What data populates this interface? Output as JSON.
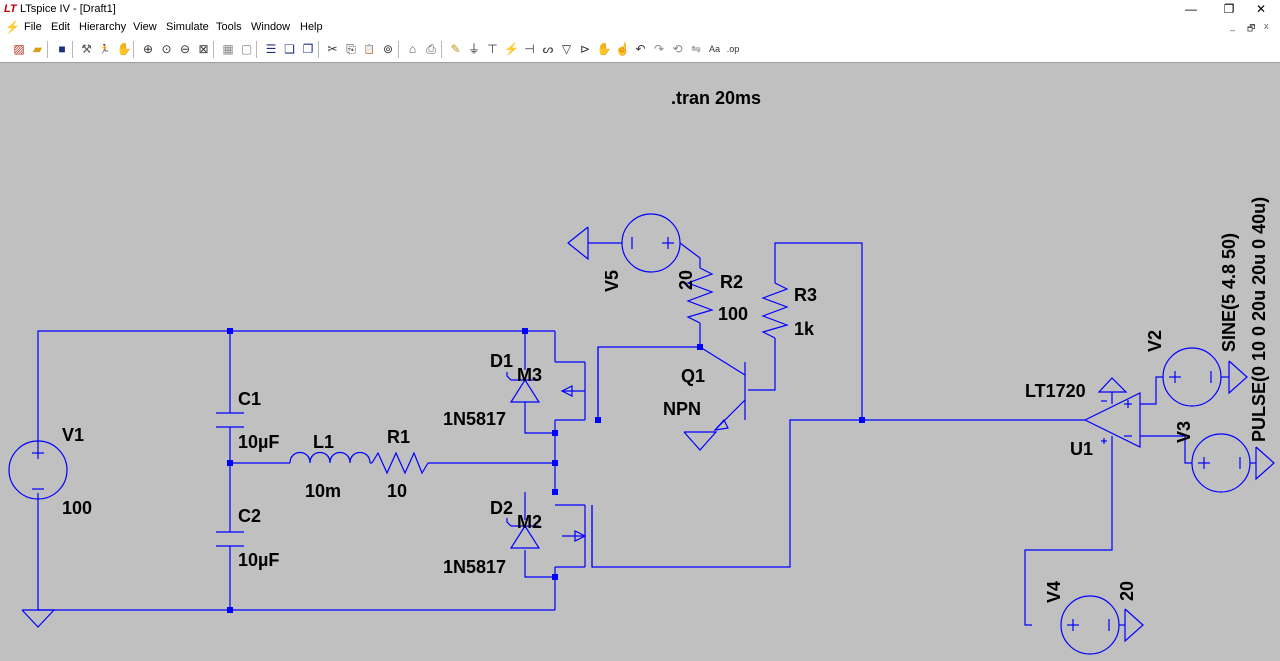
{
  "window": {
    "title": "LTspice IV - [Draft1]",
    "app_icon_glyph": "LT"
  },
  "window_controls": {
    "minimize": "—",
    "maximize": "❐",
    "close": "✕"
  },
  "mdi_controls": {
    "minimize": "_",
    "restore": "🗗",
    "close": "x"
  },
  "menu": {
    "icon_glyph": "⚡",
    "items": [
      "File",
      "Edit",
      "Hierarchy",
      "View",
      "Simulate",
      "Tools",
      "Window",
      "Help"
    ]
  },
  "toolbar": {
    "icons": [
      {
        "name": "new-schematic-icon",
        "glyph": "▨",
        "color": "#c03020"
      },
      {
        "name": "open-icon",
        "glyph": "▰",
        "color": "#d4a017"
      },
      {
        "name": "save-icon",
        "glyph": "■",
        "color": "#203080"
      },
      {
        "name": "control-panel-icon",
        "glyph": "⚒",
        "color": "#555555"
      },
      {
        "name": "run-icon",
        "glyph": "🏃",
        "color": "#203080"
      },
      {
        "name": "halt-icon",
        "glyph": "✋",
        "color": "#888888"
      },
      {
        "name": "zoom-in-icon",
        "glyph": "⊕",
        "color": "#333333"
      },
      {
        "name": "pan-icon",
        "glyph": "⊙",
        "color": "#333333"
      },
      {
        "name": "zoom-out-icon",
        "glyph": "⊖",
        "color": "#333333"
      },
      {
        "name": "zoom-fit-icon",
        "glyph": "⊠",
        "color": "#333333"
      },
      {
        "name": "autorange-icon",
        "glyph": "▦",
        "color": "#888888"
      },
      {
        "name": "zoom-reset-icon",
        "glyph": "▢",
        "color": "#888888"
      },
      {
        "name": "tile-horizontal-icon",
        "glyph": "☰",
        "color": "#203080"
      },
      {
        "name": "cascade-icon",
        "glyph": "❏",
        "color": "#203080"
      },
      {
        "name": "close-window-icon",
        "glyph": "❐",
        "color": "#203080"
      },
      {
        "name": "cut-icon",
        "glyph": "✂",
        "color": "#333333"
      },
      {
        "name": "copy-icon",
        "glyph": "⎘",
        "color": "#333333"
      },
      {
        "name": "paste-icon",
        "glyph": "📋",
        "color": "#555555"
      },
      {
        "name": "find-icon",
        "glyph": "⊚",
        "color": "#333333"
      },
      {
        "name": "print-setup-icon",
        "glyph": "⌂",
        "color": "#555555"
      },
      {
        "name": "print-icon",
        "glyph": "⎙",
        "color": "#555555"
      },
      {
        "name": "wire-icon",
        "glyph": "✎",
        "color": "#c09010"
      },
      {
        "name": "ground-icon",
        "glyph": "⏚",
        "color": "#333333"
      },
      {
        "name": "label-net-icon",
        "glyph": "⊤",
        "color": "#333333"
      },
      {
        "name": "resistor-icon",
        "glyph": "⚡",
        "color": "#333333"
      },
      {
        "name": "capacitor-icon",
        "glyph": "⊣",
        "color": "#333333"
      },
      {
        "name": "inductor-icon",
        "glyph": "ᔕ",
        "color": "#333333"
      },
      {
        "name": "diode-icon",
        "glyph": "▽",
        "color": "#333333"
      },
      {
        "name": "component-icon",
        "glyph": "⊳",
        "color": "#333333"
      },
      {
        "name": "move-icon",
        "glyph": "✋",
        "color": "#333333"
      },
      {
        "name": "drag-icon",
        "glyph": "☝",
        "color": "#333333"
      },
      {
        "name": "undo-icon",
        "glyph": "↶",
        "color": "#333333"
      },
      {
        "name": "redo-icon",
        "glyph": "↷",
        "color": "#888888"
      },
      {
        "name": "rotate-icon",
        "glyph": "⟲",
        "color": "#888888"
      },
      {
        "name": "mirror-icon",
        "glyph": "⇋",
        "color": "#888888"
      },
      {
        "name": "text-icon",
        "glyph": "Aa",
        "color": "#333333"
      },
      {
        "name": "spice-directive-icon",
        "glyph": ".op",
        "color": "#333333"
      }
    ],
    "separators_after": [
      1,
      2,
      5,
      9,
      11,
      14,
      18,
      20
    ]
  },
  "schematic": {
    "directive": ".tran 20ms",
    "labels": {
      "v1_name": "V1",
      "v1_value": "100",
      "c1_name": "C1",
      "c1_value": "10µF",
      "c2_name": "C2",
      "c2_value": "10µF",
      "l1_name": "L1",
      "l1_value": "10m",
      "r1_name": "R1",
      "r1_value": "10",
      "d1_name": "D1",
      "d1_part": "1N5817",
      "m3_name": "M3",
      "d2_name": "D2",
      "d2_part": "1N5817",
      "m2_name": "M2",
      "v5_name": "V5",
      "v5_value": "20",
      "r2_name": "R2",
      "r2_value": "100",
      "r3_name": "R3",
      "r3_value": "1k",
      "q1_name": "Q1",
      "q1_type": "NPN",
      "u1_part": "LT1720",
      "u1_name": "U1",
      "v2_name": "V2",
      "v2_value": "SINE(5 4.8 50)",
      "v3_name": "V3",
      "v3_value": "PULSE(0 10 0 20u 20u 0 40u)",
      "v4_name": "V4",
      "v4_value": "20"
    },
    "colors": {
      "wire": "#0000ff",
      "component": "#0000ff",
      "text": "#000000",
      "background": "#c0c0c0"
    }
  }
}
